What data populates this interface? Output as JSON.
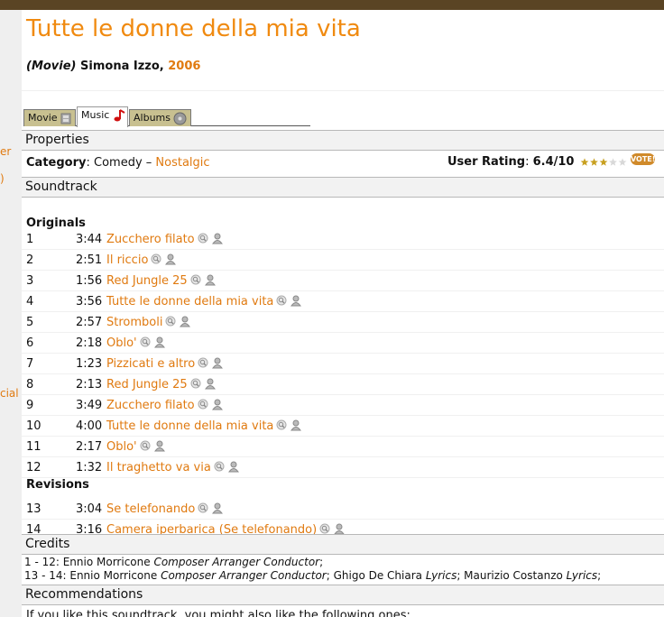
{
  "left_fragments": [
    "er",
    ")",
    "cial"
  ],
  "header": {
    "title": "Tutte le donne della mia vita",
    "kind": "(Movie)",
    "director": "Simona Izzo,",
    "year": "2006"
  },
  "tabs": [
    {
      "label": "Movie",
      "icon": "film-icon"
    },
    {
      "label": "Music",
      "icon": "music-note-icon",
      "active": true
    },
    {
      "label": "Albums",
      "icon": "disc-icon"
    }
  ],
  "properties": {
    "heading": "Properties",
    "category_label": "Category",
    "category_sep": ":",
    "category_value": "Comedy",
    "dash": "–",
    "category_tag": "Nostalgic",
    "rating_label": "User Rating",
    "rating_sep": ":",
    "rating_value": "6.4/10",
    "rating_numeric": 6.4,
    "vote_label": "VOTE!"
  },
  "soundtrack": {
    "heading": "Soundtrack",
    "groups": [
      {
        "name": "Originals",
        "tracks": [
          {
            "num": "1",
            "dur": "3:44",
            "title": "Zucchero filato"
          },
          {
            "num": "2",
            "dur": "2:51",
            "title": "Il riccio"
          },
          {
            "num": "3",
            "dur": "1:56",
            "title": "Red Jungle 25"
          },
          {
            "num": "4",
            "dur": "3:56",
            "title": "Tutte le donne della mia vita"
          },
          {
            "num": "5",
            "dur": "2:57",
            "title": "Stromboli"
          },
          {
            "num": "6",
            "dur": "2:18",
            "title": "Oblo'"
          },
          {
            "num": "7",
            "dur": "1:23",
            "title": "Pizzicati e altro"
          },
          {
            "num": "8",
            "dur": "2:13",
            "title": "Red Jungle 25"
          },
          {
            "num": "9",
            "dur": "3:49",
            "title": "Zucchero filato"
          },
          {
            "num": "10",
            "dur": "4:00",
            "title": "Tutte le donne della mia vita"
          },
          {
            "num": "11",
            "dur": "2:17",
            "title": "Oblo'"
          },
          {
            "num": "12",
            "dur": "1:32",
            "title": "Il traghetto va via"
          }
        ]
      },
      {
        "name": "Revisions",
        "tracks": [
          {
            "num": "13",
            "dur": "3:04",
            "title": "Se telefonando"
          },
          {
            "num": "14",
            "dur": "3:16",
            "title": "Camera iperbarica (Se telefonando)"
          }
        ]
      }
    ]
  },
  "credits": {
    "heading": "Credits",
    "lines": [
      [
        {
          "t": "1 - 12: Ennio Morricone "
        },
        {
          "t": "Composer Arranger Conductor",
          "i": true
        },
        {
          "t": ";"
        }
      ],
      [
        {
          "t": "13 - 14: Ennio Morricone "
        },
        {
          "t": "Composer Arranger Conductor",
          "i": true
        },
        {
          "t": "; Ghigo De Chiara "
        },
        {
          "t": "Lyrics",
          "i": true
        },
        {
          "t": "; Maurizio Costanzo "
        },
        {
          "t": "Lyrics",
          "i": true
        },
        {
          "t": ";"
        }
      ]
    ]
  },
  "recommendations": {
    "heading": "Recommendations",
    "text": "If you like this soundtrack, you might also like the following ones:"
  },
  "colors": {
    "accent": "#f08a10",
    "link": "#e07a10",
    "topbar": "#5a4424"
  }
}
